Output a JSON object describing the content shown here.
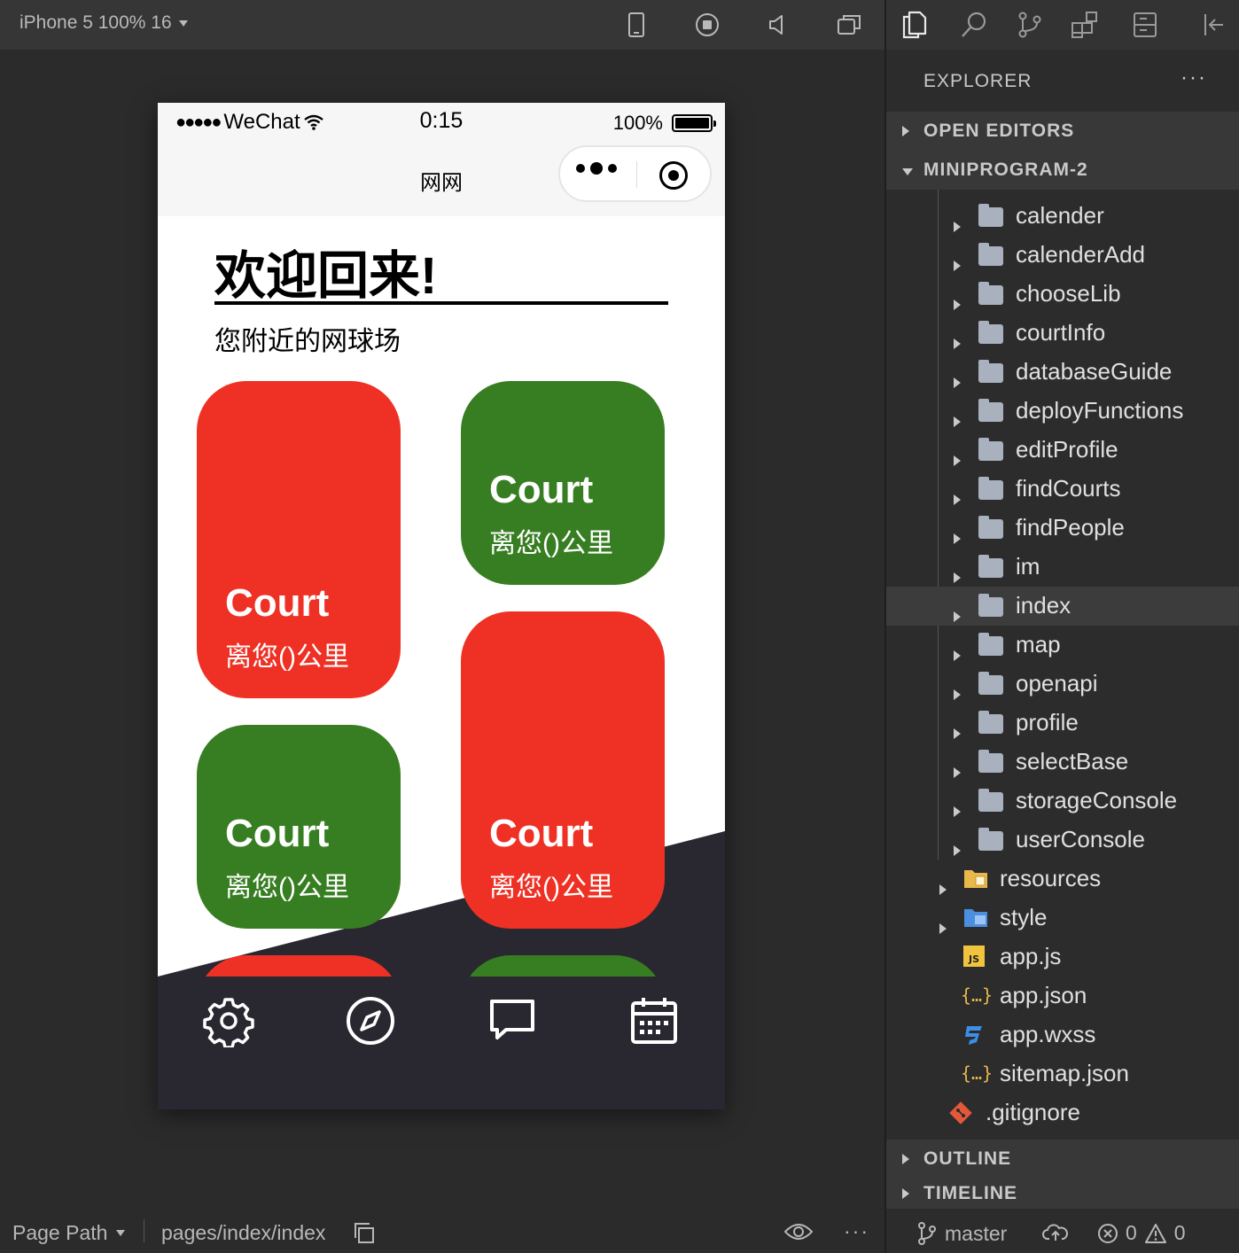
{
  "simulator": {
    "device_label": "iPhone 5 100% 16",
    "toolbar_icons": [
      "phone-icon",
      "record-icon",
      "volume-icon",
      "window-icon"
    ]
  },
  "phone": {
    "status": {
      "carrier": "WeChat",
      "time": "0:15",
      "battery": "100%"
    },
    "nav_title": "网网",
    "welcome": "欢迎回来!",
    "nearby_title": "您附近的网球场",
    "cards": [
      {
        "title": "Court",
        "subtitle": "离您()公里",
        "color": "#ee3124"
      },
      {
        "title": "Court",
        "subtitle": "离您()公里",
        "color": "#377e22"
      },
      {
        "title": "Court",
        "subtitle": "离您()公里",
        "color": "#ee3124"
      },
      {
        "title": "Court",
        "subtitle": "离您()公里",
        "color": "#377e22"
      }
    ],
    "tabs": [
      "gear-icon",
      "compass-icon",
      "chat-icon",
      "calendar-icon"
    ],
    "colors": {
      "red": "#ee3124",
      "green": "#377e22",
      "tabbar": "#292831"
    }
  },
  "explorer": {
    "title": "EXPLORER",
    "more": "···",
    "open_editors": "OPEN EDITORS",
    "project": "MINIPROGRAM-2",
    "folders": [
      "calender",
      "calenderAdd",
      "chooseLib",
      "courtInfo",
      "databaseGuide",
      "deployFunctions",
      "editProfile",
      "findCourts",
      "findPeople",
      "im",
      "index",
      "map",
      "openapi",
      "profile",
      "selectBase",
      "storageConsole",
      "userConsole"
    ],
    "selected_folder": "index",
    "root_items": [
      "resources",
      "style",
      "app.js",
      "app.json",
      "app.wxss",
      "sitemap.json",
      ".gitignore"
    ],
    "outline": "OUTLINE",
    "timeline": "TIMELINE"
  },
  "statusbar": {
    "page_path_label": "Page Path",
    "page_path": "pages/index/index",
    "more": "···",
    "branch": "master",
    "errors": "0",
    "warnings": "0"
  }
}
